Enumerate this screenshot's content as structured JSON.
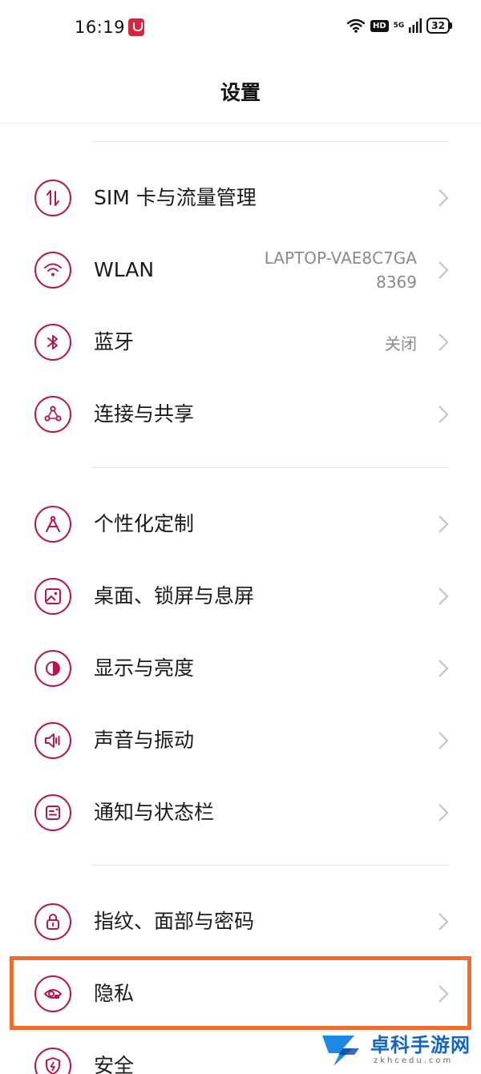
{
  "status_bar": {
    "time": "16:19",
    "network": "5G",
    "hd": "HD",
    "battery": "32"
  },
  "header": {
    "title": "设置"
  },
  "accent_color": "#b8164a",
  "sections": [
    {
      "items": [
        {
          "label": "SIM 卡与流量管理",
          "icon": "sim-traffic-icon"
        },
        {
          "label": "WLAN",
          "icon": "wifi-icon",
          "value_line1": "LAPTOP-VAE8C7GA",
          "value_line2": "8369"
        },
        {
          "label": "蓝牙",
          "icon": "bluetooth-icon",
          "value": "关闭"
        },
        {
          "label": "连接与共享",
          "icon": "connection-share-icon"
        }
      ]
    },
    {
      "items": [
        {
          "label": "个性化定制",
          "icon": "personalization-icon"
        },
        {
          "label": "桌面、锁屏与息屏",
          "icon": "wallpaper-icon"
        },
        {
          "label": "显示与亮度",
          "icon": "brightness-icon"
        },
        {
          "label": "声音与振动",
          "icon": "sound-icon"
        },
        {
          "label": "通知与状态栏",
          "icon": "notification-icon"
        }
      ]
    },
    {
      "items": [
        {
          "label": "指纹、面部与密码",
          "icon": "lock-icon"
        },
        {
          "label": "隐私",
          "icon": "privacy-eye-icon",
          "highlighted": true
        },
        {
          "label": "安全",
          "icon": "security-shield-icon"
        }
      ]
    }
  ],
  "watermark": {
    "text": "卓科手游网",
    "sub": "zkhcedu.com"
  },
  "highlight_color": "#ef6c2f"
}
